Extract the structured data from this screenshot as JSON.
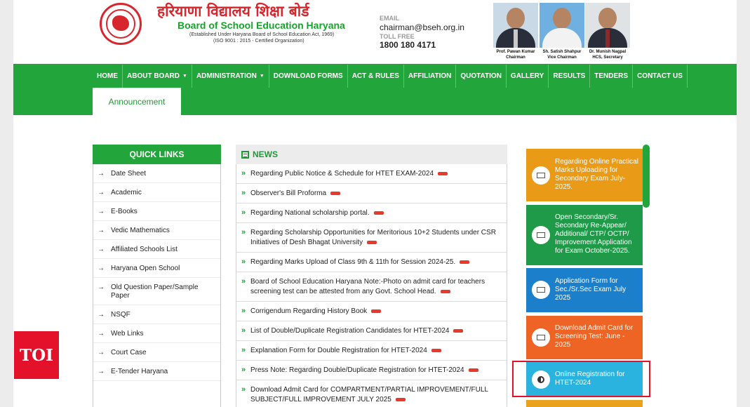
{
  "header": {
    "title_hindi": "हरियाणा विद्यालय शिक्षा बोर्ड",
    "title_english": "Board of School Education Haryana",
    "established": "(Established Under Haryana Board of School Education Act, 1969)",
    "iso": "(ISO 9001 : 2015 - Certified Organization)",
    "email_label": "EMAIL",
    "email": "chairman@bseh.org.in",
    "tollfree_label": "TOLL FREE",
    "tollfree": "1800 180 4171",
    "officials": [
      {
        "name": "Prof. Pawan Kumar",
        "role": "Chairman"
      },
      {
        "name": "Sh. Satish Shahpur",
        "role": "Vice Chairman"
      },
      {
        "name": "Dr. Munish Nagpal",
        "role": "HCS, Secretary"
      }
    ]
  },
  "nav": {
    "items": [
      "HOME",
      "ABOUT BOARD",
      "ADMINISTRATION",
      "DOWNLOAD FORMS",
      "ACT & RULES",
      "AFFILIATION",
      "QUOTATION",
      "GALLERY",
      "RESULTS",
      "TENDERS",
      "CONTACT US"
    ],
    "active_tab": "Announcement"
  },
  "quick_links": {
    "title": "QUICK LINKS",
    "items": [
      "Date Sheet",
      "Academic",
      "E-Books",
      "Vedic Mathematics",
      "Affiliated Schools List",
      "Haryana Open School",
      "Old Question Paper/Sample Paper",
      "NSQF",
      "Web Links",
      "Court Case",
      "E-Tender Haryana"
    ]
  },
  "news": {
    "title": "NEWS",
    "items": [
      "Regarding Public Notice & Schedule for HTET EXAM-2024",
      "Observer's Bill Proforma",
      "Regarding National scholarship portal.",
      "Regarding Scholarship Opportunities for Meritorious 10+2 Students under CSR Initiatives of Desh Bhagat University",
      "Regarding Marks Upload of Class 9th & 11th for Session 2024-25.",
      "Board of School Education Haryana Note:-Photo on admit card for teachers screening test can be attested from any Govt. School Head.",
      "Corrigendum Regarding History Book",
      "List of Double/Duplicate Registration Candidates for HTET-2024",
      "Explanation Form for Double Registration for HTET-2024",
      "Press Note: Regarding Double/Duplicate Registration for HTET-2024",
      "Download Admit Card for COMPARTMENT/PARTIAL IMPROVEMENT/FULL SUBJECT/FULL IMPROVEMENT JULY 2025"
    ]
  },
  "cards": [
    {
      "text": "Regarding Online Practical Marks Uploading for Secondary Exam July-2025.",
      "color": "#e99a16"
    },
    {
      "text": "Open Secondary/Sr. Secondary Re-Appear/ Additional/ CTP/ OCTP/ Improvement Application for Exam October-2025.",
      "color": "#1f9a48"
    },
    {
      "text": "Application Form for Sec./Sr.Sec Exam July 2025",
      "color": "#1b7fcc"
    },
    {
      "text": "Download Admit Card for Screening Test: June - 2025",
      "color": "#ee6424"
    },
    {
      "text": "Online Registration for HTET-2024",
      "color": "#2bb3e0"
    }
  ],
  "watermark": "TOI"
}
